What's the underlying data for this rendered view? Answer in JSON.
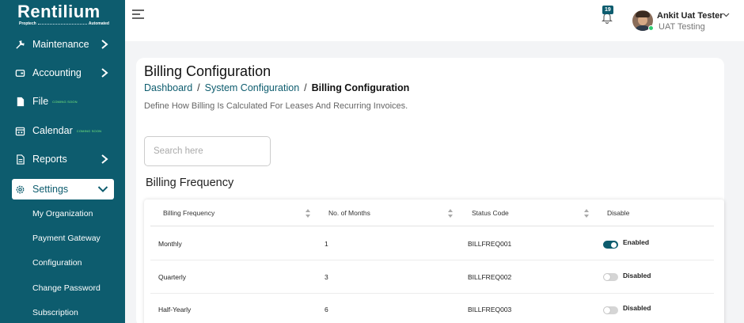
{
  "brand": {
    "name": "Rentilium",
    "tag_left": "Proptech",
    "tag_right": "Automated"
  },
  "colors": {
    "sidebar": "#0d5c6e",
    "accent": "#0d5c6e",
    "enabled_toggle": "#0d5c6e",
    "coming_soon": "#7cf07c"
  },
  "sidebar": {
    "items": [
      {
        "label": "Maintenance",
        "icon": "tools-icon"
      },
      {
        "label": "Accounting",
        "icon": "wallet-icon"
      },
      {
        "label": "File",
        "icon": "file-icon",
        "badge": "COMING SOON"
      },
      {
        "label": "Calendar",
        "icon": "calendar-icon",
        "badge": "COMING SOON"
      },
      {
        "label": "Reports",
        "icon": "report-icon"
      },
      {
        "label": "Settings",
        "icon": "gear-icon"
      }
    ],
    "sub_items": [
      "My Organization",
      "Payment Gateway",
      "Configuration",
      "Change Password",
      "Subscription"
    ]
  },
  "topbar": {
    "notification_count": "19",
    "user_name": "Ankit Uat Tester",
    "user_role": "UAT Testing"
  },
  "page": {
    "title": "Billing Configuration",
    "breadcrumb": [
      "Dashboard",
      "System Configuration",
      "Billing Configuration"
    ],
    "description": "Define How Billing Is Calculated For Leases And Recurring Invoices.",
    "search_placeholder": "Search here",
    "section_title": "Billing Frequency"
  },
  "table": {
    "columns": [
      "Billing Frequency",
      "No. of Months",
      "Status Code",
      "Disable"
    ],
    "rows": [
      {
        "frequency": "Monthly",
        "months": "1",
        "code": "BILLFREQ001",
        "status": "Enabled"
      },
      {
        "frequency": "Quarterly",
        "months": "3",
        "code": "BILLFREQ002",
        "status": "Disabled"
      },
      {
        "frequency": "Half-Yearly",
        "months": "6",
        "code": "BILLFREQ003",
        "status": "Disabled"
      }
    ]
  }
}
